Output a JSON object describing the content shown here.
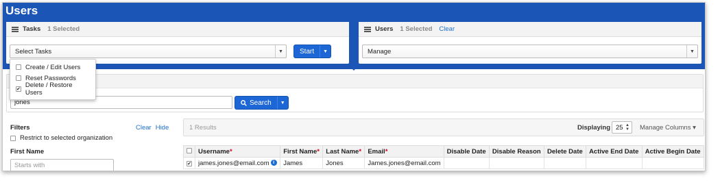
{
  "page": {
    "title": "Users"
  },
  "tasks_panel": {
    "title": "Tasks",
    "selected": "1 Selected",
    "select_value": "Select Tasks",
    "start_label": "Start"
  },
  "tasks_menu": [
    {
      "label": "Create / Edit Users",
      "checked": false
    },
    {
      "label": "Reset Passwords",
      "checked": false
    },
    {
      "label": "Delete / Restore Users",
      "checked": true
    }
  ],
  "users_panel": {
    "title": "Users",
    "selected": "1 Selected",
    "clear": "Clear",
    "select_value": "Manage"
  },
  "search": {
    "value": "jones",
    "button_label": "Search"
  },
  "filters": {
    "title": "Filters",
    "clear": "Clear",
    "hide": "Hide",
    "restrict_label": "Restrict to selected organization",
    "first_name_label": "First Name",
    "first_name_placeholder": "Starts with"
  },
  "results": {
    "count": "1 Results",
    "displaying_label": "Displaying",
    "page_size": "25",
    "manage_columns": "Manage Columns"
  },
  "table": {
    "columns": [
      {
        "label": "Username",
        "required": "*"
      },
      {
        "label": "First Name",
        "required": "*"
      },
      {
        "label": "Last Name",
        "required": "*"
      },
      {
        "label": "Email",
        "required": "*"
      },
      {
        "label": "Disable Date",
        "required": ""
      },
      {
        "label": "Disable Reason",
        "required": ""
      },
      {
        "label": "Delete Date",
        "required": ""
      },
      {
        "label": "Active End Date",
        "required": ""
      },
      {
        "label": "Active Begin Date",
        "required": ""
      }
    ],
    "rows": [
      {
        "checked": true,
        "cells": [
          "james.jones@email.com",
          "James",
          "Jones",
          "James.jones@email.com",
          "",
          "",
          "",
          "",
          ""
        ]
      }
    ]
  },
  "colors": {
    "brand": "#1b55b5",
    "button": "#1c66d6",
    "link": "#1b6fd0",
    "required": "#d0021b"
  }
}
